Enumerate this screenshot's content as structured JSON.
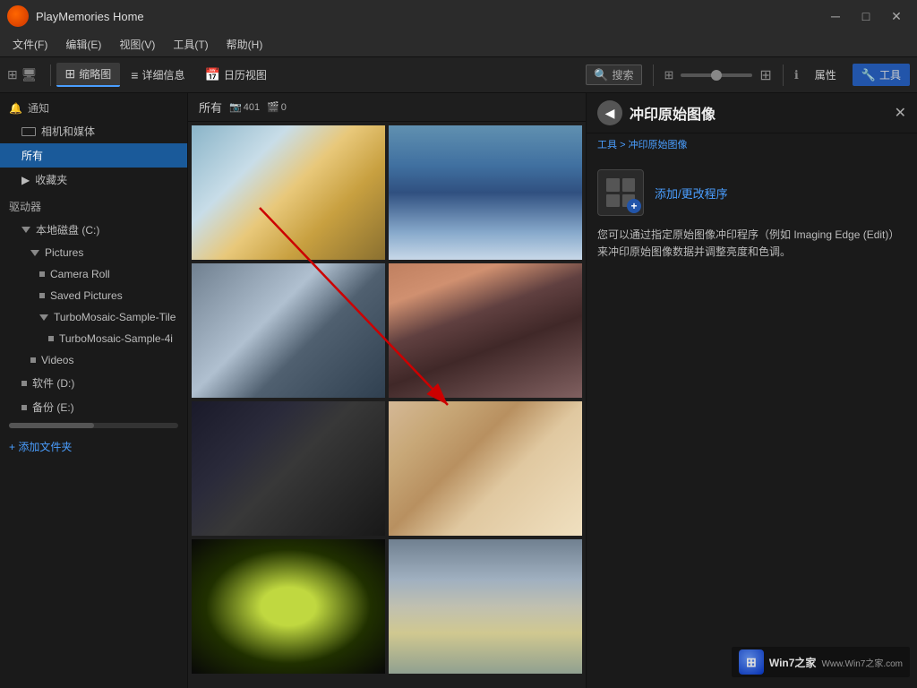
{
  "window": {
    "title": "PlayMemories Home",
    "min_label": "─",
    "max_label": "□",
    "close_label": "✕"
  },
  "menubar": {
    "items": [
      {
        "label": "文件(F)"
      },
      {
        "label": "编辑(E)"
      },
      {
        "label": "视图(V)"
      },
      {
        "label": "工具(T)"
      },
      {
        "label": "帮助(H)"
      }
    ]
  },
  "toolbar": {
    "thumbnail_label": "缩略图",
    "detail_label": "详细信息",
    "calendar_label": "日历视图",
    "search_label": "搜索",
    "attr_label": "属性",
    "tools_label": "工具"
  },
  "sidebar": {
    "notification_label": "通知",
    "camera_media_label": "相机和媒体",
    "all_label": "所有",
    "favorites_label": "收藏夹",
    "drives_label": "驱动器",
    "local_disk_c_label": "本地磁盘 (C:)",
    "pictures_label": "Pictures",
    "camera_roll_label": "Camera Roll",
    "saved_pictures_label": "Saved Pictures",
    "turbomosaic_folder_label": "TurboMosaic-Sample-Tile",
    "turbomosaic_file_label": "TurboMosaic-Sample-4i",
    "videos_label": "Videos",
    "software_d_label": "软件 (D:)",
    "backup_e_label": "备份 (E:)",
    "add_folder_label": "+ 添加文件夹"
  },
  "content": {
    "section_label": "所有",
    "count_photos": "401",
    "count_videos": "0",
    "photo_icon": "📷",
    "video_icon": "🎬"
  },
  "right_panel": {
    "title": "冲印原始图像",
    "breadcrumb": "工具 > 冲印原始图像",
    "breadcrumb_root": "工具",
    "close_label": "✕",
    "back_label": "◀",
    "add_change_label": "添加/更改程序",
    "desc": "您可以通过指定原始图像冲印程序（例如 Imaging Edge (Edit)）来冲印原始图像数据并调整亮度和色调。"
  }
}
